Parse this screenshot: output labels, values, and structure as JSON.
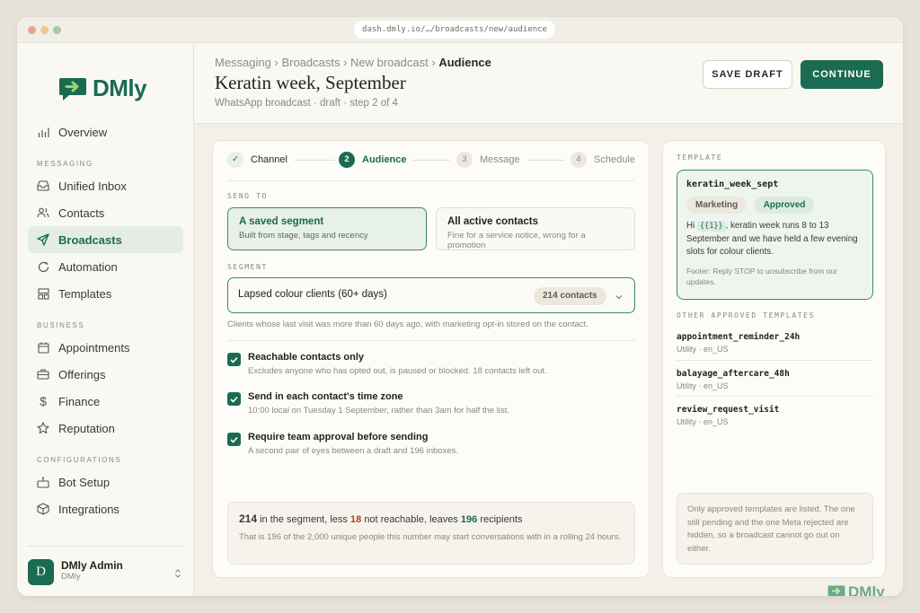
{
  "browser": {
    "url": "dash.dmly.io/…/broadcasts/new/audience"
  },
  "brand": {
    "name": "DMly",
    "accent": "#1b6b52"
  },
  "sidebar": {
    "overview": "Overview",
    "sections": {
      "messaging": "MESSAGING",
      "business": "BUSINESS",
      "configurations": "CONFIGURATIONS"
    },
    "items": {
      "unified_inbox": "Unified Inbox",
      "contacts": "Contacts",
      "broadcasts": "Broadcasts",
      "automation": "Automation",
      "templates": "Templates",
      "appointments": "Appointments",
      "offerings": "Offerings",
      "finance": "Finance",
      "reputation": "Reputation",
      "bot_setup": "Bot Setup",
      "integrations": "Integrations"
    },
    "active": "broadcasts",
    "user": {
      "initial": "D",
      "name": "DMly Admin",
      "org": "DMly"
    }
  },
  "header": {
    "breadcrumb": [
      "Messaging ›",
      "Broadcasts ›",
      "New broadcast ›"
    ],
    "breadcrumb_current": "Audience",
    "title": "Keratin week, September",
    "subtitle": "WhatsApp broadcast · draft · step 2 of 4",
    "save_label": "SAVE DRAFT",
    "continue_label": "CONTINUE"
  },
  "steps": [
    {
      "num": "✓",
      "label": "Channel",
      "state": "done"
    },
    {
      "num": "2",
      "label": "Audience",
      "state": "current"
    },
    {
      "num": "3",
      "label": "Message",
      "state": "todo"
    },
    {
      "num": "4",
      "label": "Schedule",
      "state": "todo"
    }
  ],
  "send_to": {
    "label": "SEND TO",
    "options": [
      {
        "title": "A saved segment",
        "desc": "Built from stage, tags and recency",
        "selected": true
      },
      {
        "title": "All active contacts",
        "desc": "Fine for a service notice, wrong for a promotion",
        "selected": false
      }
    ]
  },
  "segment": {
    "label": "SEGMENT",
    "value": "Lapsed colour clients (60+ days)",
    "count": "214 contacts",
    "hint": "Clients whose last visit was more than 60 days ago, with marketing opt-in stored on the contact."
  },
  "checks": [
    {
      "title": "Reachable contacts only",
      "desc": "Excludes anyone who has opted out, is paused or blocked. 18 contacts left out.",
      "checked": true
    },
    {
      "title": "Send in each contact's time zone",
      "desc": "10:00 local on Tuesday 1 September, rather than 3am for half the list.",
      "checked": true
    },
    {
      "title": "Require team approval before sending",
      "desc": "A second pair of eyes between a draft and 196 inboxes.",
      "checked": true
    }
  ],
  "summary": {
    "segment_count": "214",
    "t1": " in the segment, less ",
    "not_reachable": "18",
    "t2": " not reachable, leaves ",
    "recipients": "196",
    "t3": " recipients",
    "note": "That is 196 of the 2,000 unique people this number may start conversations with in a rolling 24 hours."
  },
  "template_panel": {
    "label": "TEMPLATE",
    "selected": {
      "name": "keratin_week_sept",
      "category": "Marketing",
      "status": "Approved",
      "body_prefix": "Hi ",
      "variable": "{{1}}",
      "body_suffix": ", keratin week runs 8 to 13 September and we have held a few evening slots for colour clients.",
      "footer": "Footer: Reply STOP to unsubscribe from our updates."
    },
    "others_label": "OTHER APPROVED TEMPLATES",
    "others": [
      {
        "name": "appointment_reminder_24h",
        "meta": "Utility · en_US"
      },
      {
        "name": "balayage_aftercare_48h",
        "meta": "Utility · en_US"
      },
      {
        "name": "review_request_visit",
        "meta": "Utility · en_US"
      }
    ],
    "note": "Only approved templates are listed. The one still pending and the one Meta rejected are hidden, so a broadcast cannot go out on either."
  },
  "watermark": "DMly"
}
